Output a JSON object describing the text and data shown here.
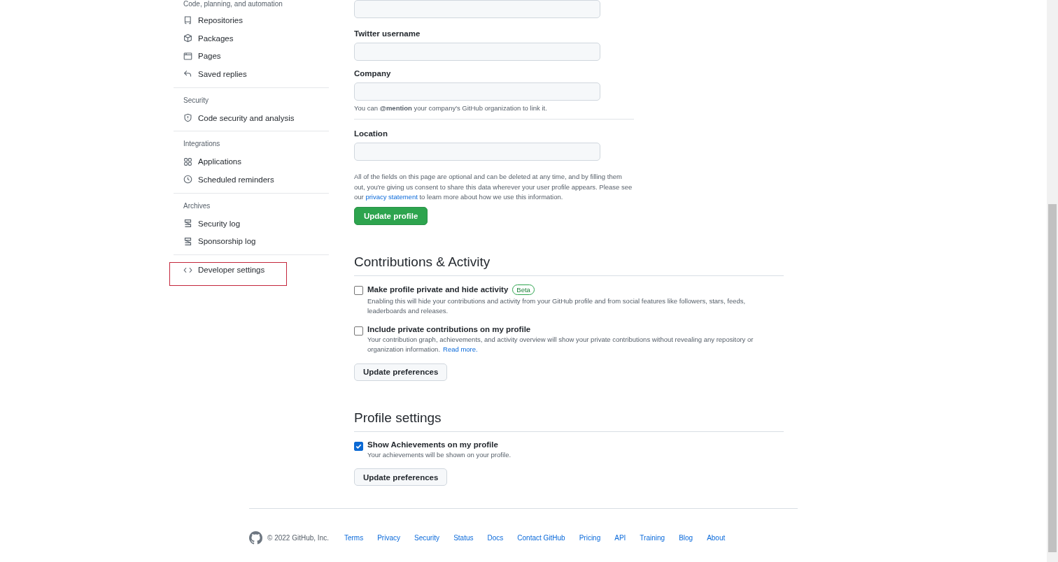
{
  "sidebar": {
    "groups": [
      {
        "heading": "Code, planning, and automation",
        "items": [
          {
            "label": "Repositories",
            "kind": "repo",
            "highlighted": false
          },
          {
            "label": "Packages",
            "kind": "package",
            "highlighted": false
          },
          {
            "label": "Pages",
            "kind": "browser",
            "highlighted": false
          },
          {
            "label": "Saved replies",
            "kind": "reply",
            "highlighted": false
          }
        ]
      },
      {
        "heading": "Security",
        "items": [
          {
            "label": "Code security and analysis",
            "kind": "shield",
            "highlighted": false
          }
        ]
      },
      {
        "heading": "Integrations",
        "items": [
          {
            "label": "Applications",
            "kind": "apps",
            "highlighted": false
          },
          {
            "label": "Scheduled reminders",
            "kind": "clock",
            "highlighted": false
          }
        ]
      },
      {
        "heading": "Archives",
        "items": [
          {
            "label": "Security log",
            "kind": "log",
            "highlighted": false
          },
          {
            "label": "Sponsorship log",
            "kind": "log",
            "highlighted": false
          }
        ]
      },
      {
        "items": [
          {
            "label": "Developer settings",
            "kind": "code",
            "highlighted": true
          }
        ]
      }
    ]
  },
  "profile_form": {
    "fields": [
      {
        "kind": "unlabeled"
      },
      {
        "kind": "labeled",
        "label": "Twitter username"
      },
      {
        "kind": "labeled",
        "label": "Company",
        "note": "You can **@mention** your company's GitHub organization to link it.",
        "divider": true
      },
      {
        "kind": "labeled",
        "label": "Location"
      }
    ],
    "notice": {
      "before": "All of the fields on this page are optional and can be deleted at any time, and by filling them out, you're giving us consent to share this data wherever your user profile appears. Please see our",
      "link": "privacy statement",
      "after": "to learn more about how we use this information."
    },
    "button": "Update profile"
  },
  "sections": [
    {
      "title": "Contributions & Activity",
      "options": [
        {
          "label": "Make profile private and hide activity",
          "badge": "Beta",
          "checked": false,
          "description": "Enabling this will hide your contributions and activity from your GitHub profile and from social features like followers, stars, feeds, leaderboards and releases."
        },
        {
          "label": "Include private contributions on my profile",
          "checked": false,
          "description": "Your contribution graph, achievements, and activity overview will show your private contributions without revealing any repository or organization information.",
          "link": "Read more."
        }
      ],
      "button": "Update preferences"
    },
    {
      "title": "Profile settings",
      "options": [
        {
          "label": "Show Achievements on my profile",
          "checked": true,
          "description": "Your achievements will be shown on your profile."
        }
      ],
      "button": "Update preferences"
    }
  ],
  "footer": {
    "copyright": "© 2022 GitHub, Inc.",
    "links": [
      "Terms",
      "Privacy",
      "Security",
      "Status",
      "Docs",
      "Contact GitHub",
      "Pricing",
      "API",
      "Training",
      "Blog",
      "About"
    ]
  }
}
